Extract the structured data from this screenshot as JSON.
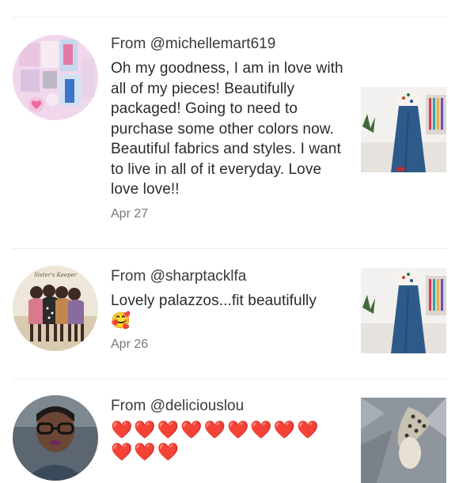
{
  "reviews": [
    {
      "from": "From @michellemart619",
      "text": "Oh my goodness, I am in love with all of my pieces! Beautifully packaged! Going to need to purchase some other colors now. Beautiful fabrics and styles. I want to live in all of it everyday. Love love love!!",
      "date": "Apr 27",
      "avatar_icon": "collage-avatar",
      "thumb_icon": "wide-leg-jeans-photo"
    },
    {
      "from": "From @sharptacklfa",
      "text": "Lovely palazzos...fit beautifully",
      "emoji": "🥰",
      "date": "Apr 26",
      "avatar_icon": "sisters-artwork-avatar",
      "thumb_icon": "wide-leg-jeans-photo"
    },
    {
      "from": "From @deliciouslou",
      "hearts": "❤️❤️❤️❤️❤️❤️❤️❤️❤️❤️❤️❤️",
      "avatar_icon": "woman-glasses-avatar",
      "thumb_icon": "snake-print-sandal-photo"
    }
  ],
  "colors": {
    "heart": "#e11d2e",
    "denim": "#2e5a8a",
    "divider": "#ececec"
  }
}
